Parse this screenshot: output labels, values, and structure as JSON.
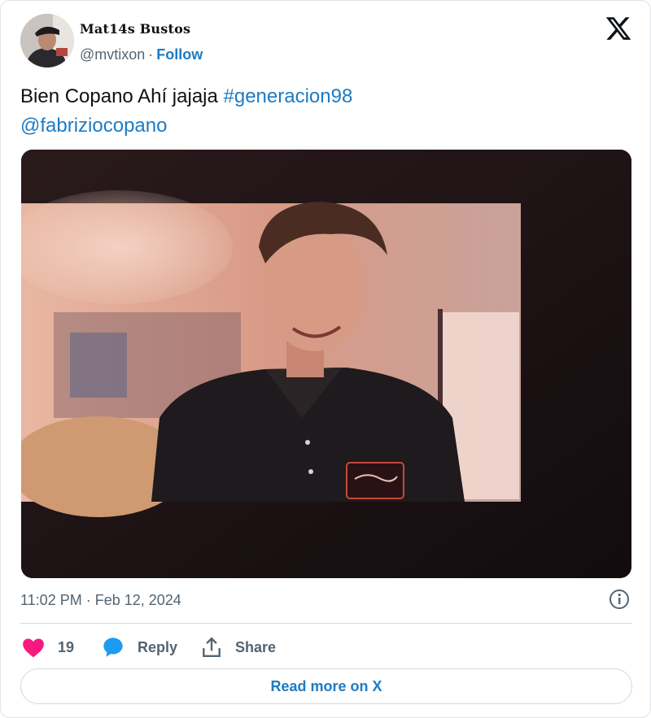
{
  "author": {
    "name": "Mat14s Bustos",
    "handle": "@mvtixon",
    "separator": "·",
    "follow_label": "Follow"
  },
  "tweet": {
    "text_plain": "Bien Copano Ahí jajaja ",
    "hashtag": "#generacion98",
    "mention": "@fabriziocopano"
  },
  "meta": {
    "timestamp": "11:02 PM · Feb 12, 2024"
  },
  "actions": {
    "like_count": "19",
    "reply_label": "Reply",
    "share_label": "Share"
  },
  "footer": {
    "read_more_label": "Read more on X"
  },
  "icons": {
    "brand": "x-logo-icon",
    "like": "heart-icon",
    "reply": "speech-bubble-icon",
    "share": "share-upload-icon",
    "info": "info-icon"
  },
  "colors": {
    "link": "#1d7bc4",
    "like": "#f91880",
    "reply": "#1d9bf0",
    "muted": "#536471"
  }
}
